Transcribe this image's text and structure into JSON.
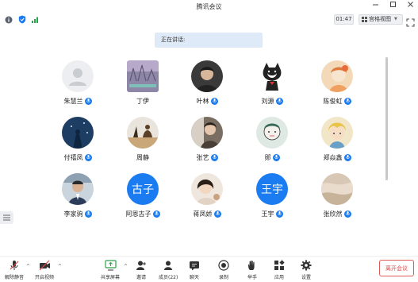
{
  "window": {
    "title": "腾讯会议"
  },
  "status": {
    "timer": "01:47",
    "view_label": "宫格视图"
  },
  "speaking": {
    "label": "正在讲话:"
  },
  "participants": [
    {
      "name": "朱慧兰",
      "mic": true
    },
    {
      "name": "丁伊",
      "mic": false
    },
    {
      "name": "叶林",
      "mic": true
    },
    {
      "name": "刘源",
      "mic": true
    },
    {
      "name": "陈俊虹",
      "mic": true
    },
    {
      "name": "付禧凤",
      "mic": true
    },
    {
      "name": "周静",
      "mic": false
    },
    {
      "name": "张艺",
      "mic": true
    },
    {
      "name": "郧",
      "mic": true
    },
    {
      "name": "郑焱鑫",
      "mic": true
    },
    {
      "name": "李家驹",
      "mic": true
    },
    {
      "name": "阿恩古子",
      "mic": true,
      "avatar_text": "古子"
    },
    {
      "name": "蒋凤娇",
      "mic": true
    },
    {
      "name": "王宇",
      "mic": true,
      "avatar_text": "王宇"
    },
    {
      "name": "张欣然",
      "mic": true
    }
  ],
  "toolbar": {
    "mute": "解除静音",
    "video": "开启视频",
    "share": "共享屏幕",
    "invite": "邀请",
    "members": "成员(22)",
    "chat": "聊天",
    "record": "录制",
    "hand": "举手",
    "apps": "应用",
    "settings": "设置",
    "leave": "离开会议"
  },
  "colors": {
    "accent": "#1a7cf0",
    "leave": "#e04848",
    "banner": "#dfeaf8"
  }
}
